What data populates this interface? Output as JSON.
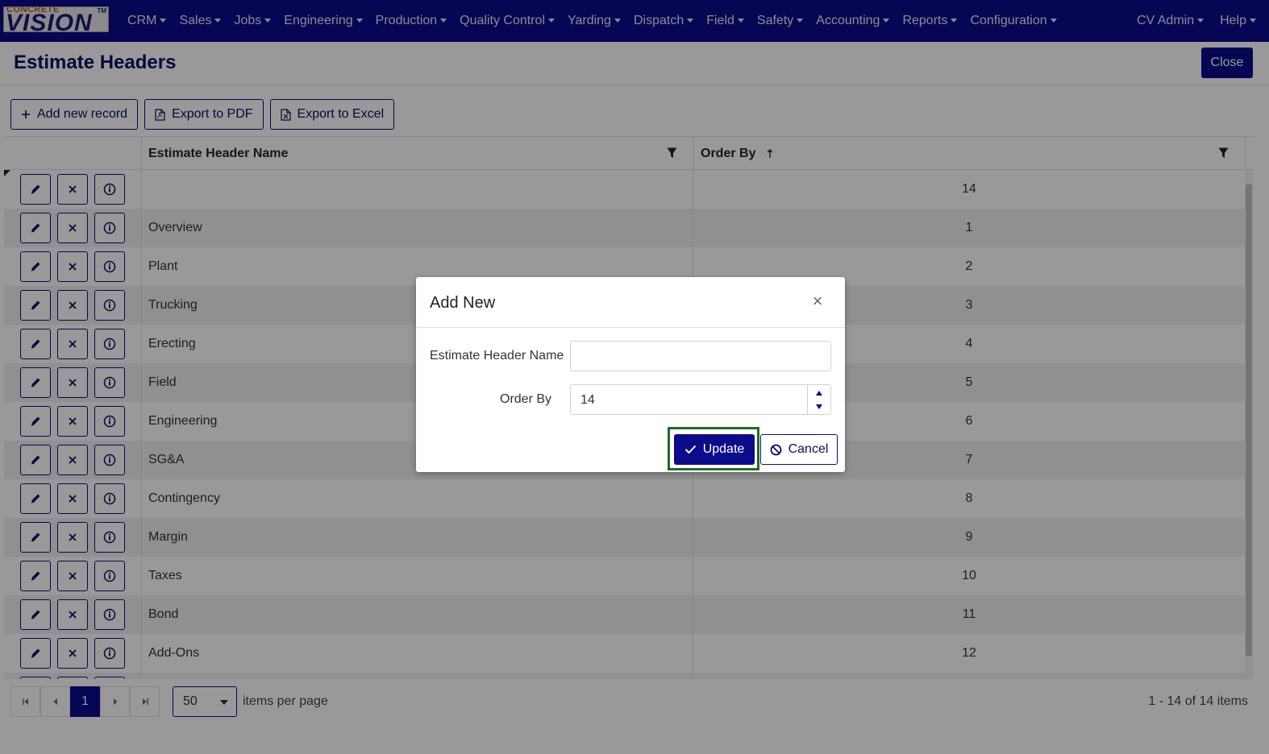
{
  "app": {
    "logo_small_text": "CONCRETE",
    "logo_text": "VISION",
    "logo_tm": "TM",
    "brand_color": "#0b0b8c"
  },
  "nav": {
    "items": [
      {
        "label": "CRM"
      },
      {
        "label": "Sales"
      },
      {
        "label": "Jobs"
      },
      {
        "label": "Engineering"
      },
      {
        "label": "Production"
      },
      {
        "label": "Quality Control"
      },
      {
        "label": "Yarding"
      },
      {
        "label": "Dispatch"
      },
      {
        "label": "Field"
      },
      {
        "label": "Safety"
      },
      {
        "label": "Accounting"
      },
      {
        "label": "Reports"
      },
      {
        "label": "Configuration"
      }
    ],
    "right_items": [
      {
        "label": "CV Admin"
      },
      {
        "label": "Help"
      }
    ]
  },
  "page": {
    "title": "Estimate Headers",
    "close_label": "Close"
  },
  "toolbar": {
    "add_label": "Add new record",
    "pdf_label": "Export to PDF",
    "excel_label": "Export to Excel"
  },
  "grid": {
    "columns": {
      "name": "Estimate Header Name",
      "order": "Order By"
    },
    "sort_indicator": "ascending",
    "rows": [
      {
        "name": "",
        "order": "14"
      },
      {
        "name": "Overview",
        "order": "1"
      },
      {
        "name": "Plant",
        "order": "2"
      },
      {
        "name": "Trucking",
        "order": "3"
      },
      {
        "name": "Erecting",
        "order": "4"
      },
      {
        "name": "Field",
        "order": "5"
      },
      {
        "name": "Engineering",
        "order": "6"
      },
      {
        "name": "SG&A",
        "order": "7"
      },
      {
        "name": "Contingency",
        "order": "8"
      },
      {
        "name": "Margin",
        "order": "9"
      },
      {
        "name": "Taxes",
        "order": "10"
      },
      {
        "name": "Bond",
        "order": "11"
      },
      {
        "name": "Add-Ons",
        "order": "12"
      },
      {
        "name": "",
        "order": ""
      }
    ]
  },
  "pager": {
    "current_page": "1",
    "page_size": "50",
    "items_per_page_label": "items per page",
    "info": "1 - 14 of 14 items"
  },
  "modal": {
    "title": "Add New",
    "fields": {
      "name_label": "Estimate Header Name",
      "name_value": "",
      "order_label": "Order By",
      "order_value": "14"
    },
    "update_label": "Update",
    "cancel_label": "Cancel",
    "focus_outline_color": "#1e6b23"
  }
}
